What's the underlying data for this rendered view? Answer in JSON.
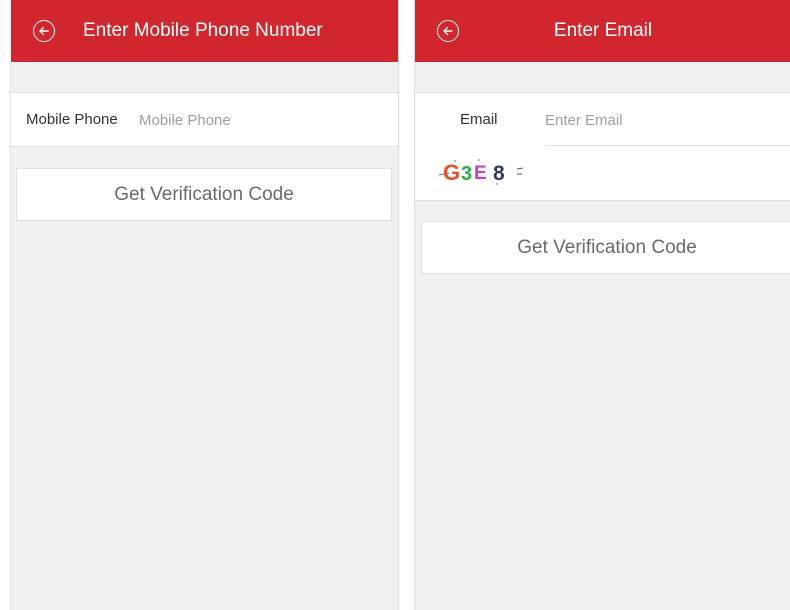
{
  "left_screen": {
    "title": "Enter Mobile Phone Number",
    "phone_label": "Mobile Phone",
    "phone_placeholder": "Mobile Phone",
    "button_label": "Get Verification Code"
  },
  "right_screen": {
    "title": "Enter Email",
    "email_label": "Email",
    "email_placeholder": "Enter Email",
    "captcha_text": "G3E8",
    "button_label": "Get Verification Code"
  },
  "colors": {
    "header": "#d2262e",
    "background": "#f1f1f1"
  },
  "icons": {
    "back": "back-arrow-circle-icon"
  }
}
